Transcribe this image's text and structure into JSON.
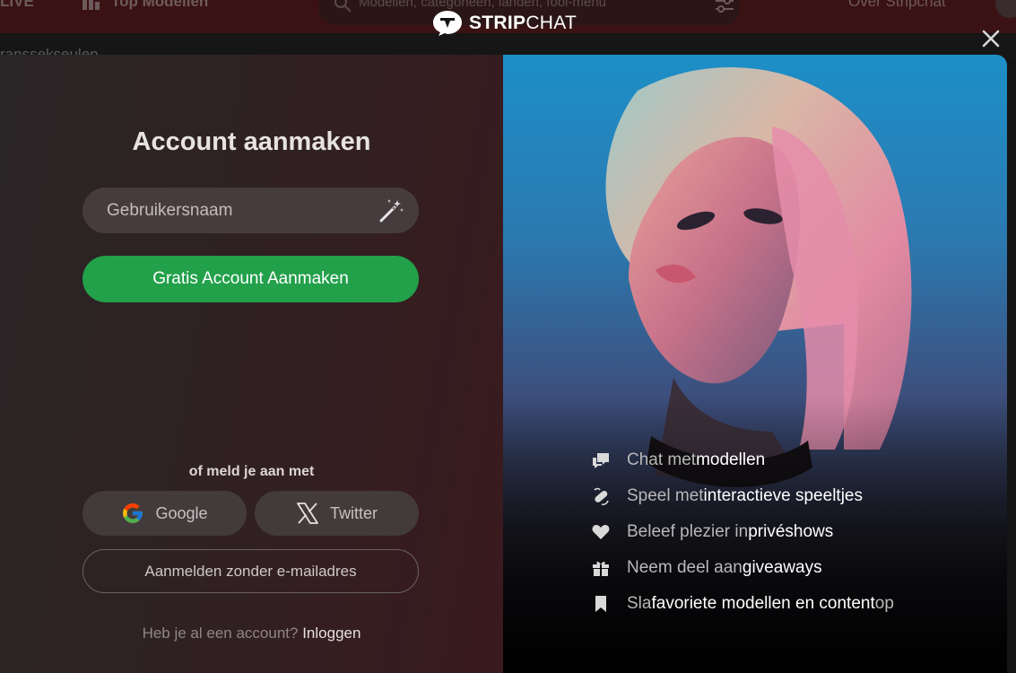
{
  "background": {
    "nav_live": "LIVE",
    "nav_top_models": "Top Modellen",
    "search_placeholder": "Modellen, categorieën, landen, fooi-menu",
    "nav_about": "Over Stripchat",
    "subnav_text": "ranssekseulen"
  },
  "logo": {
    "part_bold": "STRIP",
    "part_thin": "CHAT"
  },
  "modal": {
    "title": "Account aanmaken",
    "username_placeholder": "Gebruikersnaam",
    "primary_button": "Gratis Account Aanmaken",
    "alt_signin_label": "of meld je aan met",
    "social": {
      "google": "Google",
      "twitter": "Twitter"
    },
    "no_email_button": "Aanmelden zonder e-mailadres",
    "login_prompt": "Heb je al een account?",
    "login_link": "Inloggen"
  },
  "features": [
    {
      "icon": "chat-bubbles-icon",
      "dim1": "Chat met ",
      "bright1": "modellen",
      "dim2": "",
      "bright2": "",
      "dim3": ""
    },
    {
      "icon": "toy-icon",
      "dim1": "Speel met ",
      "bright1": "interactieve speeltjes",
      "dim2": "",
      "bright2": "",
      "dim3": ""
    },
    {
      "icon": "heart-icon",
      "dim1": "Beleef plezier in ",
      "bright1": "privéshows",
      "dim2": "",
      "bright2": "",
      "dim3": ""
    },
    {
      "icon": "gift-icon",
      "dim1": "Neem deel aan ",
      "bright1": "giveaways",
      "dim2": "",
      "bright2": "",
      "dim3": ""
    },
    {
      "icon": "bookmark-icon",
      "dim1": "Sla ",
      "bright1": "favoriete modellen en content",
      "dim2": " op",
      "bright2": "",
      "dim3": ""
    }
  ],
  "colors": {
    "primary_green": "#22a04a",
    "modal_left_bg": "#2f2123",
    "header_bg": "#3a1214"
  }
}
